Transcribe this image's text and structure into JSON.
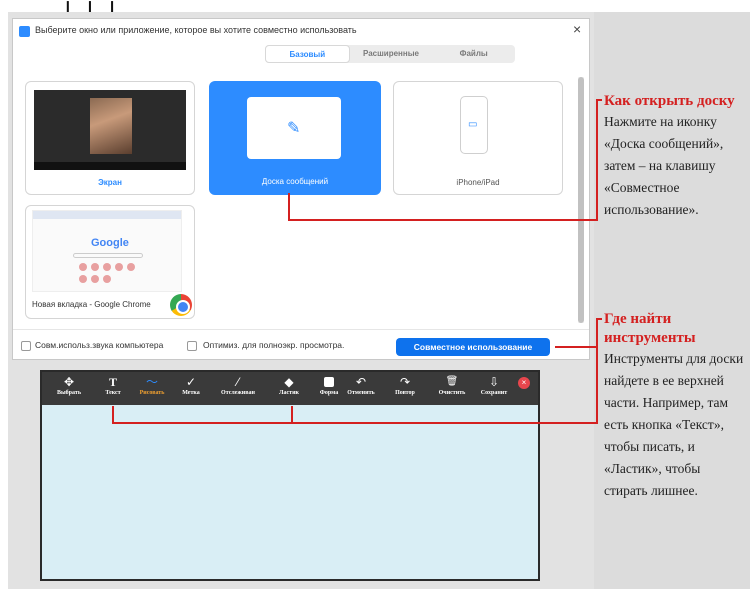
{
  "dialog": {
    "title": "Выберите окно или приложение, которое вы хотите совместно использовать",
    "close_symbol": "×",
    "tabs": [
      {
        "label": "Базовый",
        "active": true
      },
      {
        "label": "Расширенные",
        "active": false
      },
      {
        "label": "Файлы",
        "active": false
      }
    ],
    "options": {
      "screen": "Экран",
      "whiteboard": "Доска сообщений",
      "iphone": "iPhone/iPad",
      "chrome": "Новая вкладка - Google Chrome",
      "google_logo_text": "Google"
    },
    "footer": {
      "share_sound": "Совм.использ.звука компьютера",
      "optimize": "Оптимиз. для полноэкр. просмотра.",
      "share_button": "Совместное использование"
    }
  },
  "whiteboard": {
    "tools": [
      {
        "id": "select",
        "label": "Выбрать",
        "icon": "✥",
        "icon_name": "move-icon"
      },
      {
        "id": "text",
        "label": "Текст",
        "icon": "T",
        "icon_name": "text-icon"
      },
      {
        "id": "draw",
        "label": "Рисовать",
        "icon": "〜",
        "icon_name": "draw-icon",
        "active": true
      },
      {
        "id": "stamp",
        "label": "Метка",
        "icon": "✓",
        "icon_name": "stamp-icon"
      },
      {
        "id": "spotlight",
        "label": "Отслеживан",
        "icon": "⁄",
        "icon_name": "spotlight-icon"
      },
      {
        "id": "eraser",
        "label": "Ластик",
        "icon": "◆",
        "icon_name": "eraser-icon"
      },
      {
        "id": "format",
        "label": "Форма",
        "icon": "",
        "icon_name": "format-icon"
      },
      {
        "id": "undo",
        "label": "Отменить",
        "icon": "↶",
        "icon_name": "undo-icon"
      },
      {
        "id": "redo",
        "label": "Повтор",
        "icon": "↷",
        "icon_name": "redo-icon"
      },
      {
        "id": "clear",
        "label": "Очистить",
        "icon": "🗑",
        "icon_name": "trash-icon"
      },
      {
        "id": "save",
        "label": "Сохранит",
        "icon": "⇩",
        "icon_name": "save-icon"
      }
    ],
    "close_symbol": "×"
  },
  "annotations": [
    {
      "heading": "Как открыть доску",
      "body": "Нажмите на иконку «Доска сообщений», затем – на клавишу «Совместное использование»."
    },
    {
      "heading": "Где найти инструменты",
      "body": "Инструменты для доски найдете в ее верхней части. Например, там есть кнопка «Текст», чтобы писать, и «Ластик», чтобы стирать лишнее."
    }
  ],
  "colors": {
    "accent": "#2d8cff",
    "callout_red": "#d42020",
    "board_bg": "#d9eef5",
    "toolbar_bg": "#3a3a3a"
  }
}
